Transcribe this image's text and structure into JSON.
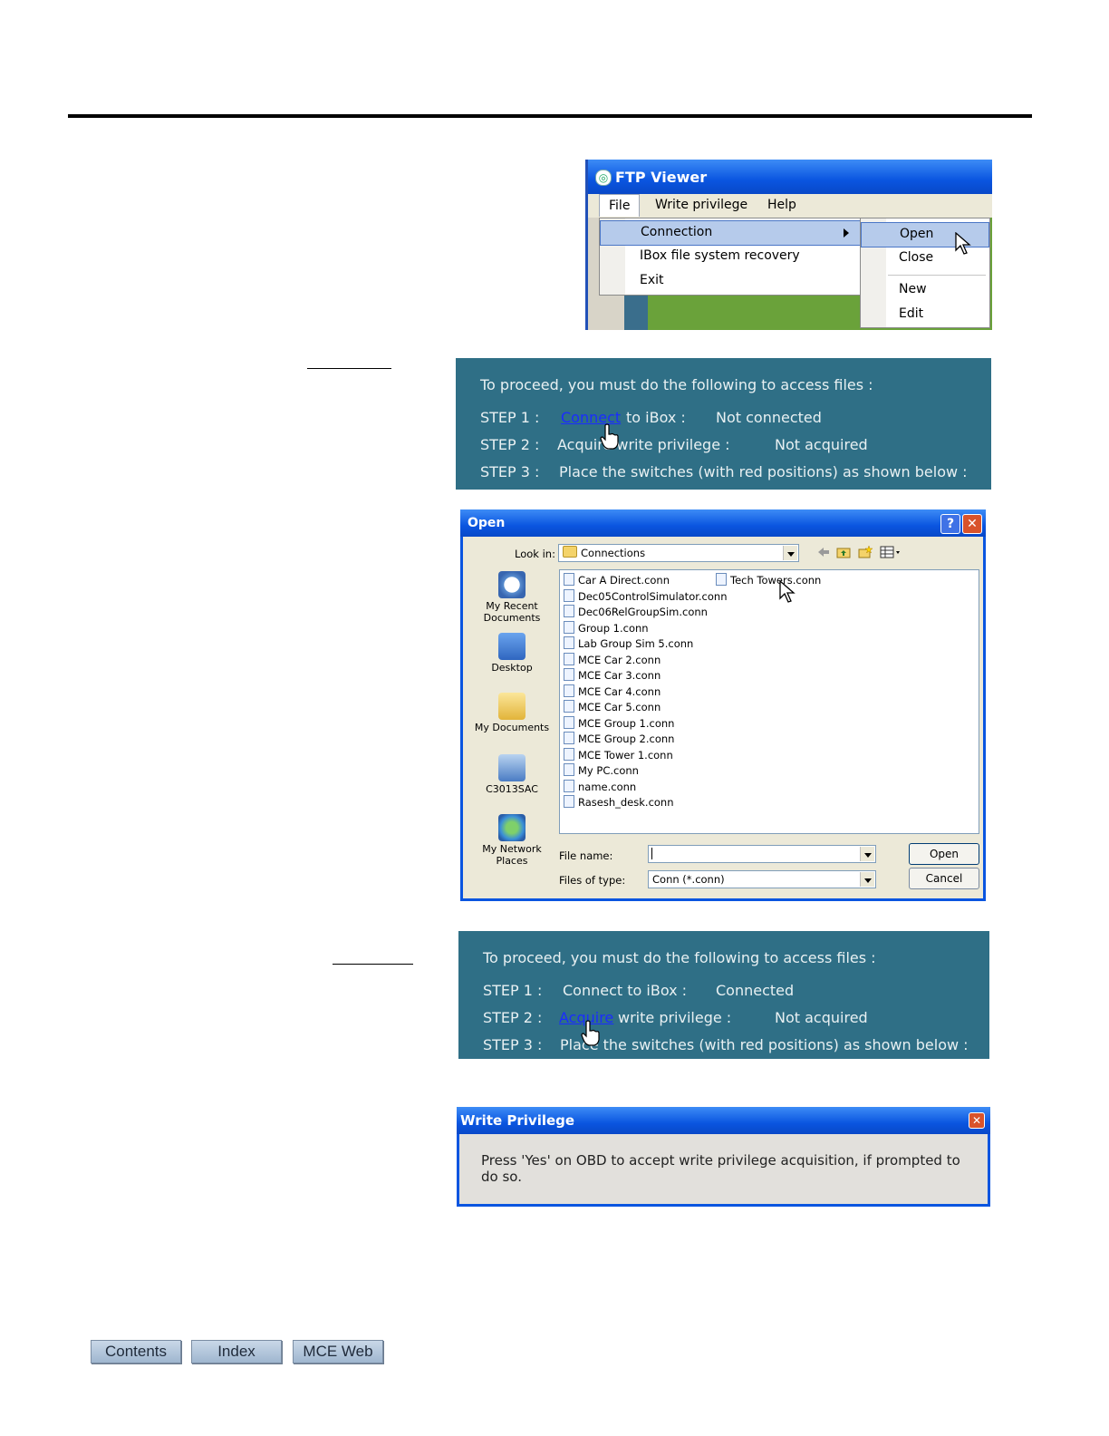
{
  "ftp_viewer": {
    "title": "FTP Viewer",
    "menu": [
      "File",
      "Write privilege",
      "Help"
    ],
    "file_menu": [
      "Connection",
      "IBox file system recovery",
      "Exit"
    ],
    "connection_submenu": [
      "Open",
      "Close",
      "New",
      "Edit"
    ]
  },
  "panel_step1": {
    "intro": "To proceed, you must do the following to access files :",
    "step1_label": "STEP 1 :",
    "step1_link": "Connect",
    "step1_text": "to iBox :",
    "step1_status": "Not connected",
    "step2_label": "STEP 2 :",
    "step2_text": "Acquire write privilege :",
    "step2_status": "Not acquired",
    "step3_label": "STEP 3 :",
    "step3_text": "Place the switches (with red positions) as shown below :"
  },
  "open_dialog": {
    "title": "Open",
    "look_in_label": "Look in:",
    "look_in_value": "Connections",
    "places": [
      "My Recent Documents",
      "Desktop",
      "My Documents",
      "C3013SAC",
      "My Network Places"
    ],
    "files_col1": [
      "Car A Direct.conn",
      "Dec05ControlSimulator.conn",
      "Dec06RelGroupSim.conn",
      "Group 1.conn",
      "Lab Group Sim 5.conn",
      "MCE Car 2.conn",
      "MCE Car 3.conn",
      "MCE Car 4.conn",
      "MCE Car 5.conn",
      "MCE Group 1.conn",
      "MCE Group 2.conn",
      "MCE Tower 1.conn",
      "My PC.conn",
      "name.conn",
      "Rasesh_desk.conn"
    ],
    "files_col2": [
      "Tech Towers.conn"
    ],
    "file_name_label": "File name:",
    "file_name_value": "",
    "file_type_label": "Files of type:",
    "file_type_value": "Conn (*.conn)",
    "open_button": "Open",
    "cancel_button": "Cancel"
  },
  "panel_step2": {
    "intro": "To proceed, you must do the following to access files :",
    "step1_label": "STEP 1 :",
    "step1_text": "Connect to iBox :",
    "step1_status": "Connected",
    "step2_label": "STEP 2 :",
    "step2_link": "Acquire",
    "step2_text": "write privilege :",
    "step2_status": "Not acquired",
    "step3_label": "STEP 3 :",
    "step3_text": "Place the switches (with red positions) as shown below :"
  },
  "write_privilege_dialog": {
    "title": "Write Privilege",
    "message": "Press 'Yes' on OBD to accept write privilege acquisition, if prompted to do so."
  },
  "nav": {
    "contents": "Contents",
    "index": "Index",
    "web": "MCE Web"
  }
}
